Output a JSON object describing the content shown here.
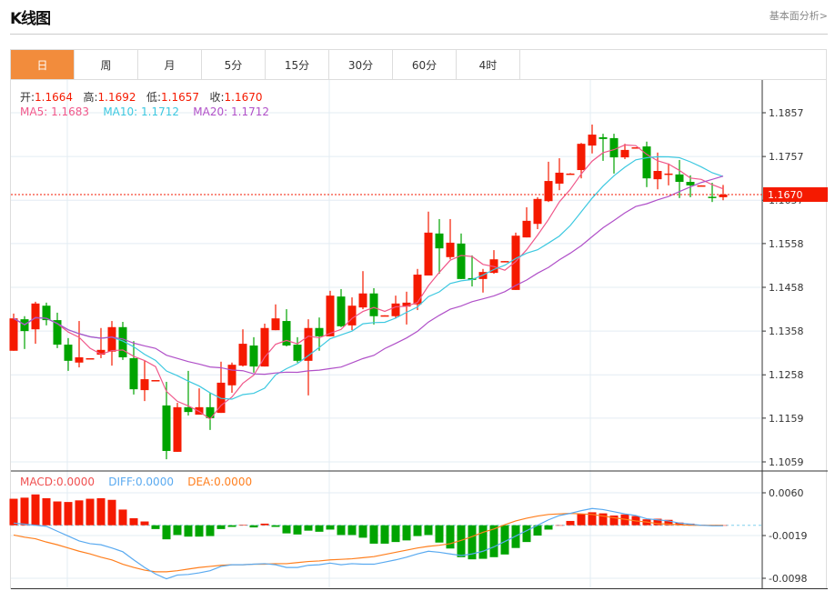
{
  "header": {
    "title": "K线图",
    "link": "基本面分析>"
  },
  "tabs": [
    {
      "label": "日",
      "active": true
    },
    {
      "label": "周"
    },
    {
      "label": "月"
    },
    {
      "label": "5分"
    },
    {
      "label": "15分"
    },
    {
      "label": "30分"
    },
    {
      "label": "60分"
    },
    {
      "label": "4时"
    }
  ],
  "ohlc": {
    "open_label": "开:",
    "open": "1.1664",
    "high_label": "高:",
    "high": "1.1692",
    "low_label": "低:",
    "low": "1.1657",
    "close_label": "收:",
    "close": "1.1670"
  },
  "ma": {
    "ma5_label": "MA5: ",
    "ma5": "1.1683",
    "ma10_label": "MA10: ",
    "ma10": "1.1712",
    "ma20_label": "MA20: ",
    "ma20": "1.1712"
  },
  "macd_info": {
    "macd": "MACD:0.0000",
    "diff": "DIFF:0.0000",
    "dea": "DEA:0.0000"
  },
  "current_price": "1.1670",
  "colors": {
    "up": "#f51a00",
    "down": "#00a400",
    "ma5": "#f0578a",
    "ma10": "#3cc8e0",
    "ma20": "#b050c8",
    "diff": "#5aaaf0",
    "dea": "#ff7f1e",
    "accent": "#f28c3c"
  },
  "chart_data": {
    "type": "candlestick",
    "price_axis": {
      "ticks": [
        "1.1857",
        "1.1757",
        "1.1657",
        "1.1558",
        "1.1458",
        "1.1358",
        "1.1258",
        "1.1159",
        "1.1059"
      ],
      "range": [
        1.1059,
        1.1857
      ]
    },
    "macd_axis": {
      "ticks": [
        "0.0060",
        "-0.0019",
        "-0.0098"
      ],
      "range": [
        -0.0098,
        0.006
      ]
    },
    "candles_ochl": [
      [
        1.1313,
        1.1387,
        1.1398,
        1.1313
      ],
      [
        1.1385,
        1.1358,
        1.1392,
        1.1317
      ],
      [
        1.1362,
        1.1421,
        1.1425,
        1.1329
      ],
      [
        1.1416,
        1.1383,
        1.1423,
        1.1371
      ],
      [
        1.1383,
        1.1327,
        1.14,
        1.1319
      ],
      [
        1.1327,
        1.129,
        1.1342,
        1.1267
      ],
      [
        1.1286,
        1.1298,
        1.1381,
        1.1275
      ],
      [
        1.1296,
        1.1296,
        1.1296,
        1.1296
      ],
      [
        1.1304,
        1.1315,
        1.1365,
        1.1296
      ],
      [
        1.1311,
        1.1367,
        1.1381,
        1.1279
      ],
      [
        1.1367,
        1.1298,
        1.1379,
        1.1292
      ],
      [
        1.1296,
        1.1225,
        1.1335,
        1.1213
      ],
      [
        1.1223,
        1.1248,
        1.129,
        1.1198
      ],
      [
        1.1246,
        1.1246,
        1.1246,
        1.1246
      ],
      [
        1.1188,
        1.1084,
        1.1242,
        1.1065
      ],
      [
        1.1082,
        1.1184,
        1.1194,
        1.1082
      ],
      [
        1.1184,
        1.1173,
        1.1267,
        1.1165
      ],
      [
        1.1167,
        1.1184,
        1.1227,
        1.1167
      ],
      [
        1.1184,
        1.1159,
        1.1217,
        1.1132
      ],
      [
        1.1171,
        1.124,
        1.1288,
        1.1171
      ],
      [
        1.1234,
        1.1281,
        1.1286,
        1.1217
      ],
      [
        1.1279,
        1.1329,
        1.1362,
        1.1277
      ],
      [
        1.1325,
        1.1277,
        1.1344,
        1.1263
      ],
      [
        1.1277,
        1.1365,
        1.1375,
        1.1277
      ],
      [
        1.136,
        1.1387,
        1.1419,
        1.136
      ],
      [
        1.1381,
        1.1325,
        1.1408,
        1.1323
      ],
      [
        1.1327,
        1.129,
        1.1344,
        1.1286
      ],
      [
        1.129,
        1.1365,
        1.1385,
        1.1211
      ],
      [
        1.1365,
        1.1346,
        1.1389,
        1.1313
      ],
      [
        1.1346,
        1.1439,
        1.145,
        1.1346
      ],
      [
        1.1437,
        1.1369,
        1.1454,
        1.1367
      ],
      [
        1.1371,
        1.1416,
        1.1435,
        1.136
      ],
      [
        1.1412,
        1.1444,
        1.1495,
        1.1408
      ],
      [
        1.1444,
        1.1392,
        1.1456,
        1.1373
      ],
      [
        1.1392,
        1.1394,
        1.1394,
        1.1392
      ],
      [
        1.1392,
        1.1421,
        1.1439,
        1.1387
      ],
      [
        1.1414,
        1.1423,
        1.1448,
        1.1373
      ],
      [
        1.1419,
        1.1487,
        1.15,
        1.1406
      ],
      [
        1.1485,
        1.1583,
        1.1631,
        1.1485
      ],
      [
        1.1581,
        1.1547,
        1.1614,
        1.1489
      ],
      [
        1.1527,
        1.156,
        1.1614,
        1.1522
      ],
      [
        1.1558,
        1.1477,
        1.1581,
        1.1477
      ],
      [
        1.1479,
        1.1475,
        1.1531,
        1.146
      ],
      [
        1.1477,
        1.1493,
        1.15,
        1.1446
      ],
      [
        1.1491,
        1.1522,
        1.1543,
        1.1489
      ],
      [
        1.1516,
        1.1518,
        1.1518,
        1.1516
      ],
      [
        1.1452,
        1.1576,
        1.1583,
        1.1452
      ],
      [
        1.1572,
        1.161,
        1.1641,
        1.1572
      ],
      [
        1.1603,
        1.166,
        1.1664,
        1.1591
      ],
      [
        1.1655,
        1.1701,
        1.1745,
        1.1653
      ],
      [
        1.1695,
        1.172,
        1.1753,
        1.168
      ],
      [
        1.1717,
        1.1718,
        1.1719,
        1.1716
      ],
      [
        1.1726,
        1.1786,
        1.1788,
        1.1707
      ],
      [
        1.1782,
        1.1807,
        1.183,
        1.1764
      ],
      [
        1.1801,
        1.1797,
        1.1809,
        1.1747
      ],
      [
        1.1799,
        1.1755,
        1.1809,
        1.1718
      ],
      [
        1.1755,
        1.1772,
        1.1786,
        1.1751
      ],
      [
        1.1777,
        1.1778,
        1.1778,
        1.1777
      ],
      [
        1.178,
        1.1707,
        1.1791,
        1.1687
      ],
      [
        1.1705,
        1.1724,
        1.1766,
        1.1682
      ],
      [
        1.1717,
        1.1718,
        1.1741,
        1.1691
      ],
      [
        1.1716,
        1.1699,
        1.1749,
        1.1662
      ],
      [
        1.1699,
        1.1691,
        1.1714,
        1.1664
      ],
      [
        1.169,
        1.1691,
        1.1691,
        1.169
      ],
      [
        1.1665,
        1.1664,
        1.1697,
        1.1653
      ],
      [
        1.1664,
        1.167,
        1.1692,
        1.1657
      ]
    ],
    "macd_hist": [
      0.0049,
      0.0051,
      0.0057,
      0.005,
      0.0044,
      0.0043,
      0.0046,
      0.0049,
      0.005,
      0.0047,
      0.0029,
      0.0013,
      0.0007,
      -0.0007,
      -0.0026,
      -0.0018,
      -0.0021,
      -0.0021,
      -0.002,
      -0.0007,
      -0.0003,
      0.0001,
      -0.0004,
      0.0003,
      -0.0003,
      -0.0015,
      -0.0017,
      -0.001,
      -0.0012,
      -0.0008,
      -0.0018,
      -0.0018,
      -0.0023,
      -0.0034,
      -0.0034,
      -0.0031,
      -0.0028,
      -0.002,
      -0.0018,
      -0.0032,
      -0.0043,
      -0.0059,
      -0.0063,
      -0.0062,
      -0.0059,
      -0.0054,
      -0.0042,
      -0.0031,
      -0.0019,
      -0.0008,
      0.0,
      0.0008,
      0.0021,
      0.0024,
      0.0022,
      0.0018,
      0.002,
      0.0017,
      0.0011,
      0.0012,
      0.001,
      0.0005,
      0.0003,
      0.0001,
      0.0,
      0.0
    ],
    "diff": [
      0.0004,
      0.0002,
      0,
      -0.0002,
      -0.0011,
      -0.002,
      -0.0029,
      -0.0034,
      -0.0036,
      -0.0042,
      -0.0049,
      -0.0064,
      -0.0078,
      -0.009,
      -0.0099,
      -0.0092,
      -0.0091,
      -0.0088,
      -0.0084,
      -0.0076,
      -0.0073,
      -0.0073,
      -0.0072,
      -0.0071,
      -0.0073,
      -0.0078,
      -0.0078,
      -0.0074,
      -0.0073,
      -0.007,
      -0.0073,
      -0.0071,
      -0.0072,
      -0.0072,
      -0.0068,
      -0.0064,
      -0.0059,
      -0.0053,
      -0.0048,
      -0.005,
      -0.0053,
      -0.0056,
      -0.0053,
      -0.0048,
      -0.004,
      -0.003,
      -0.002,
      -0.001,
      0.0,
      0.001,
      0.0018,
      0.0022,
      0.0027,
      0.0031,
      0.0029,
      0.0025,
      0.0021,
      0.0018,
      0.0012,
      0.001,
      0.0008,
      0.0004,
      0.0002,
      0,
      -0.0001,
      -0.0001
    ],
    "dea": [
      -0.0018,
      -0.0022,
      -0.0025,
      -0.0031,
      -0.0036,
      -0.0042,
      -0.0048,
      -0.0053,
      -0.0059,
      -0.0064,
      -0.0072,
      -0.0078,
      -0.0083,
      -0.0086,
      -0.0086,
      -0.0084,
      -0.0081,
      -0.0078,
      -0.0076,
      -0.0074,
      -0.0073,
      -0.0073,
      -0.0072,
      -0.0072,
      -0.0071,
      -0.0071,
      -0.0069,
      -0.0067,
      -0.0066,
      -0.0064,
      -0.0063,
      -0.0062,
      -0.006,
      -0.0058,
      -0.0054,
      -0.005,
      -0.0046,
      -0.0042,
      -0.0039,
      -0.0037,
      -0.0034,
      -0.0028,
      -0.0021,
      -0.0013,
      -0.0007,
      0.0001,
      0.0008,
      0.0013,
      0.0017,
      0.002,
      0.0021,
      0.0022,
      0.0021,
      0.002,
      0.0017,
      0.0014,
      0.0011,
      0.0008,
      0.0006,
      0.0003,
      0.0002,
      0.0001,
      0,
      0,
      0,
      0
    ]
  }
}
